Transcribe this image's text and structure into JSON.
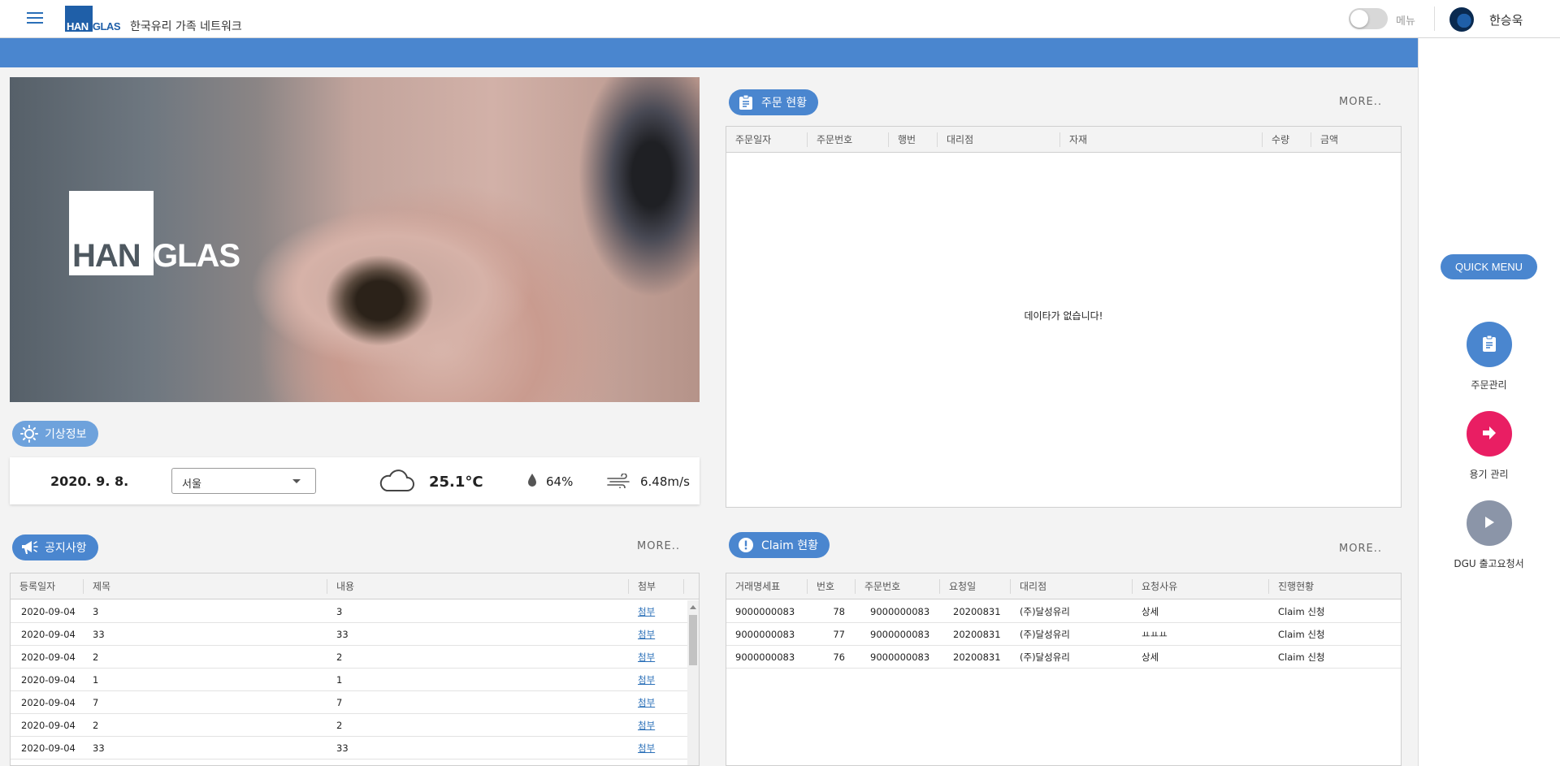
{
  "header": {
    "logo_han": "HAN",
    "logo_glas": "GLAS",
    "site_title": "한국유리 가족 네트워크",
    "menu_label": "메뉴",
    "username": "한승욱"
  },
  "hero": {
    "logo_han": "HAN",
    "logo_glas": "GLAS"
  },
  "weather": {
    "title": "기상정보",
    "date": "2020. 9. 8.",
    "city": "서울",
    "temperature": "25.1°C",
    "humidity": "64%",
    "wind": "6.48m/s",
    "icons": [
      "sun-icon",
      "cloud-icon",
      "water-drop-icon",
      "wind-icon"
    ]
  },
  "notice": {
    "title": "공지사항",
    "more": "MORE..",
    "columns": [
      "등록일자",
      "제목",
      "내용",
      "첨부"
    ],
    "rows": [
      {
        "date": "2020-09-04",
        "title": "3",
        "content": "3",
        "attach": "첨부"
      },
      {
        "date": "2020-09-04",
        "title": "33",
        "content": "33",
        "attach": "첨부"
      },
      {
        "date": "2020-09-04",
        "title": "2",
        "content": "2",
        "attach": "첨부"
      },
      {
        "date": "2020-09-04",
        "title": "1",
        "content": "1",
        "attach": "첨부"
      },
      {
        "date": "2020-09-04",
        "title": "7",
        "content": "7",
        "attach": "첨부"
      },
      {
        "date": "2020-09-04",
        "title": "2",
        "content": "2",
        "attach": "첨부"
      },
      {
        "date": "2020-09-04",
        "title": "33",
        "content": "33",
        "attach": "첨부"
      }
    ]
  },
  "orders": {
    "title": "주문 현황",
    "more": "MORE..",
    "columns": [
      "주문일자",
      "주문번호",
      "행번",
      "대리점",
      "자재",
      "수량",
      "금액"
    ],
    "empty_message": "데이타가 없습니다!"
  },
  "claims": {
    "title": "Claim 현황",
    "more": "MORE..",
    "columns": [
      "거래명세표",
      "번호",
      "주문번호",
      "요청일",
      "대리점",
      "요청사유",
      "진행현황"
    ],
    "rows": [
      {
        "invoice": "9000000083",
        "no": "78",
        "order_no": "9000000083",
        "req_date": "20200831",
        "agency": "(주)달성유리",
        "reason": "상세",
        "status": "Claim 신청"
      },
      {
        "invoice": "9000000083",
        "no": "77",
        "order_no": "9000000083",
        "req_date": "20200831",
        "agency": "(주)달성유리",
        "reason": "ㅛㅛㅛ",
        "status": "Claim 신청"
      },
      {
        "invoice": "9000000083",
        "no": "76",
        "order_no": "9000000083",
        "req_date": "20200831",
        "agency": "(주)달성유리",
        "reason": "상세",
        "status": "Claim 신청"
      }
    ]
  },
  "quick_menu": {
    "title": "QUICK MENU",
    "items": [
      {
        "label": "주문관리",
        "icon": "clipboard-icon",
        "color": "#4a86cf"
      },
      {
        "label": "용기 관리",
        "icon": "arrow-right-icon",
        "color": "#e91e63"
      },
      {
        "label": "DGU 출고요청서",
        "icon": "play-icon",
        "color": "#8b95a8"
      }
    ]
  },
  "colors": {
    "primary": "#4a86cf",
    "accent": "#e91e63",
    "muted": "#8b95a8"
  }
}
